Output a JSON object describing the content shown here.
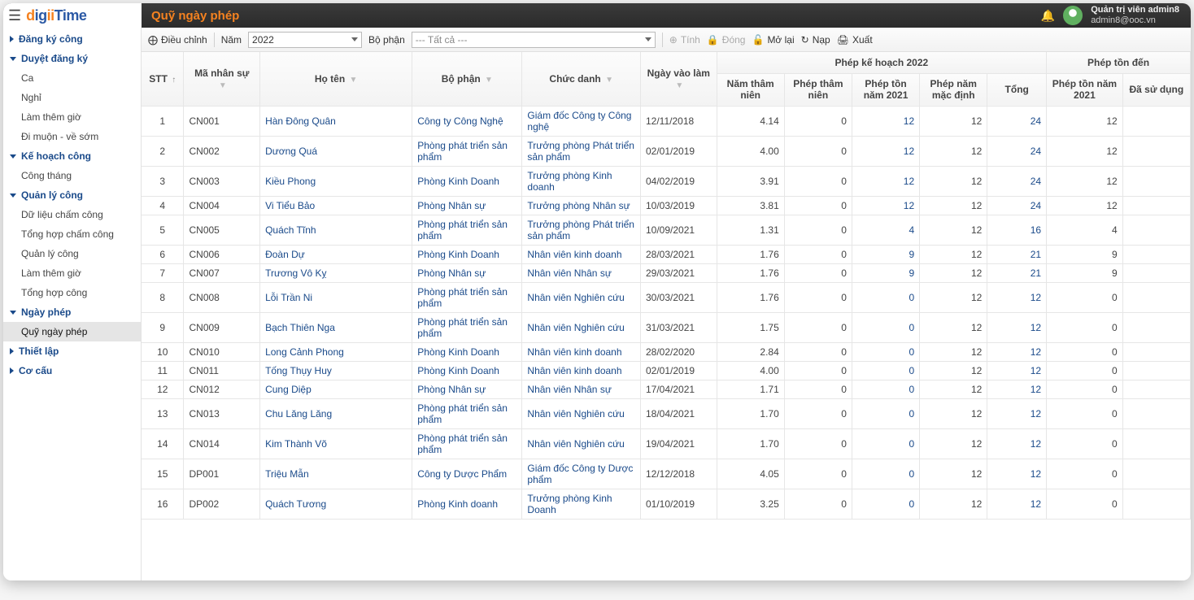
{
  "header": {
    "brand_d": "d",
    "brand_ig": "ig",
    "brand_ii": "ii",
    "brand_time": "Time",
    "page_title": "Quỹ ngày phép",
    "user_name": "Quản trị viên admin8",
    "user_email": "admin8@ooc.vn"
  },
  "sidebar": {
    "s0": "Đăng ký công",
    "s1": "Duyệt đăng ký",
    "s1a": "Ca",
    "s1b": "Nghỉ",
    "s1c": "Làm thêm giờ",
    "s1d": "Đi muộn - về sớm",
    "s2": "Kế hoạch công",
    "s2a": "Công tháng",
    "s3": "Quản lý công",
    "s3a": "Dữ liệu chấm công",
    "s3b": "Tổng hợp chấm công",
    "s3c": "Quản lý công",
    "s3d": "Làm thêm giờ",
    "s3e": "Tổng hợp công",
    "s4": "Ngày phép",
    "s4a": "Quỹ ngày phép",
    "s5": "Thiết lập",
    "s6": "Cơ cấu"
  },
  "toolbar": {
    "adjust": "Điều chỉnh",
    "year_label": "Năm",
    "year_value": "2022",
    "dept_label": "Bộ phận",
    "dept_value": "--- Tất cả ---",
    "calc": "Tính",
    "close": "Đóng",
    "reopen": "Mở lại",
    "refresh": "Nạp",
    "export": "Xuất"
  },
  "columns": {
    "stt": "STT",
    "ma": "Mã nhân sự",
    "hoten": "Họ tên",
    "bophan": "Bộ phận",
    "chucdanh": "Chức danh",
    "ngayvao": "Ngày vào làm",
    "group_plan": "Phép kế hoạch 2022",
    "namtn": "Năm thâm niên",
    "pheptn": "Phép thâm niên",
    "phepton21": "Phép tồn năm 2021",
    "phepmd": "Phép năm mặc định",
    "tong": "Tổng",
    "group_ton": "Phép tồn đến",
    "phepton21b": "Phép tồn năm 2021",
    "dasd": "Đã sử dụng"
  },
  "rows": [
    {
      "stt": "1",
      "ma": "CN001",
      "ten": "Hàn Đông Quân",
      "bp": "Công ty Công Nghệ",
      "cd": "Giám đốc Công ty Công nghệ",
      "ngay": "12/11/2018",
      "ntn": "4.14",
      "ptn": "0",
      "pt21": "12",
      "pnm": "12",
      "tong": "24",
      "pt21b": "12",
      "dsd": ""
    },
    {
      "stt": "2",
      "ma": "CN002",
      "ten": "Dương Quá",
      "bp": "Phòng phát triển sản phẩm",
      "cd": "Trưởng phòng Phát triển sản phẩm",
      "ngay": "02/01/2019",
      "ntn": "4.00",
      "ptn": "0",
      "pt21": "12",
      "pnm": "12",
      "tong": "24",
      "pt21b": "12",
      "dsd": ""
    },
    {
      "stt": "3",
      "ma": "CN003",
      "ten": "Kiều Phong",
      "bp": "Phòng Kinh Doanh",
      "cd": "Trưởng phòng Kinh doanh",
      "ngay": "04/02/2019",
      "ntn": "3.91",
      "ptn": "0",
      "pt21": "12",
      "pnm": "12",
      "tong": "24",
      "pt21b": "12",
      "dsd": ""
    },
    {
      "stt": "4",
      "ma": "CN004",
      "ten": "Vi Tiểu Bảo",
      "bp": "Phòng Nhân sự",
      "cd": "Trưởng phòng Nhân sự",
      "ngay": "10/03/2019",
      "ntn": "3.81",
      "ptn": "0",
      "pt21": "12",
      "pnm": "12",
      "tong": "24",
      "pt21b": "12",
      "dsd": ""
    },
    {
      "stt": "5",
      "ma": "CN005",
      "ten": "Quách Tĩnh",
      "bp": "Phòng phát triển sản phẩm",
      "cd": "Trưởng phòng Phát triển sản phẩm",
      "ngay": "10/09/2021",
      "ntn": "1.31",
      "ptn": "0",
      "pt21": "4",
      "pnm": "12",
      "tong": "16",
      "pt21b": "4",
      "dsd": ""
    },
    {
      "stt": "6",
      "ma": "CN006",
      "ten": "Đoàn Dự",
      "bp": "Phòng Kinh Doanh",
      "cd": "Nhân viên kinh doanh",
      "ngay": "28/03/2021",
      "ntn": "1.76",
      "ptn": "0",
      "pt21": "9",
      "pnm": "12",
      "tong": "21",
      "pt21b": "9",
      "dsd": ""
    },
    {
      "stt": "7",
      "ma": "CN007",
      "ten": "Trương Vô Kỵ",
      "bp": "Phòng Nhân sự",
      "cd": "Nhân viên Nhân sự",
      "ngay": "29/03/2021",
      "ntn": "1.76",
      "ptn": "0",
      "pt21": "9",
      "pnm": "12",
      "tong": "21",
      "pt21b": "9",
      "dsd": ""
    },
    {
      "stt": "8",
      "ma": "CN008",
      "ten": "Lỗi Trần Ni",
      "bp": "Phòng phát triển sản phẩm",
      "cd": "Nhân viên Nghiên cứu",
      "ngay": "30/03/2021",
      "ntn": "1.76",
      "ptn": "0",
      "pt21": "0",
      "pnm": "12",
      "tong": "12",
      "pt21b": "0",
      "dsd": ""
    },
    {
      "stt": "9",
      "ma": "CN009",
      "ten": "Bạch Thiên Nga",
      "bp": "Phòng phát triển sản phẩm",
      "cd": "Nhân viên Nghiên cứu",
      "ngay": "31/03/2021",
      "ntn": "1.75",
      "ptn": "0",
      "pt21": "0",
      "pnm": "12",
      "tong": "12",
      "pt21b": "0",
      "dsd": ""
    },
    {
      "stt": "10",
      "ma": "CN010",
      "ten": "Long Cảnh Phong",
      "bp": "Phòng Kinh Doanh",
      "cd": "Nhân viên kinh doanh",
      "ngay": "28/02/2020",
      "ntn": "2.84",
      "ptn": "0",
      "pt21": "0",
      "pnm": "12",
      "tong": "12",
      "pt21b": "0",
      "dsd": ""
    },
    {
      "stt": "11",
      "ma": "CN011",
      "ten": "Tống Thụy Huy",
      "bp": "Phòng Kinh Doanh",
      "cd": "Nhân viên kinh doanh",
      "ngay": "02/01/2019",
      "ntn": "4.00",
      "ptn": "0",
      "pt21": "0",
      "pnm": "12",
      "tong": "12",
      "pt21b": "0",
      "dsd": ""
    },
    {
      "stt": "12",
      "ma": "CN012",
      "ten": "Cung Diệp",
      "bp": "Phòng Nhân sự",
      "cd": "Nhân viên Nhân sự",
      "ngay": "17/04/2021",
      "ntn": "1.71",
      "ptn": "0",
      "pt21": "0",
      "pnm": "12",
      "tong": "12",
      "pt21b": "0",
      "dsd": ""
    },
    {
      "stt": "13",
      "ma": "CN013",
      "ten": "Chu Lăng Lăng",
      "bp": "Phòng phát triển sản phẩm",
      "cd": "Nhân viên Nghiên cứu",
      "ngay": "18/04/2021",
      "ntn": "1.70",
      "ptn": "0",
      "pt21": "0",
      "pnm": "12",
      "tong": "12",
      "pt21b": "0",
      "dsd": ""
    },
    {
      "stt": "14",
      "ma": "CN014",
      "ten": "Kim Thành Võ",
      "bp": "Phòng phát triển sản phẩm",
      "cd": "Nhân viên Nghiên cứu",
      "ngay": "19/04/2021",
      "ntn": "1.70",
      "ptn": "0",
      "pt21": "0",
      "pnm": "12",
      "tong": "12",
      "pt21b": "0",
      "dsd": ""
    },
    {
      "stt": "15",
      "ma": "DP001",
      "ten": "Triệu Mẫn",
      "bp": "Công ty Dược Phẩm",
      "cd": "Giám đốc Công ty Dược phẩm",
      "ngay": "12/12/2018",
      "ntn": "4.05",
      "ptn": "0",
      "pt21": "0",
      "pnm": "12",
      "tong": "12",
      "pt21b": "0",
      "dsd": ""
    },
    {
      "stt": "16",
      "ma": "DP002",
      "ten": "Quách Tương",
      "bp": "Phòng Kinh doanh",
      "cd": "Trưởng phòng Kinh Doanh",
      "ngay": "01/10/2019",
      "ntn": "3.25",
      "ptn": "0",
      "pt21": "0",
      "pnm": "12",
      "tong": "12",
      "pt21b": "0",
      "dsd": ""
    }
  ]
}
